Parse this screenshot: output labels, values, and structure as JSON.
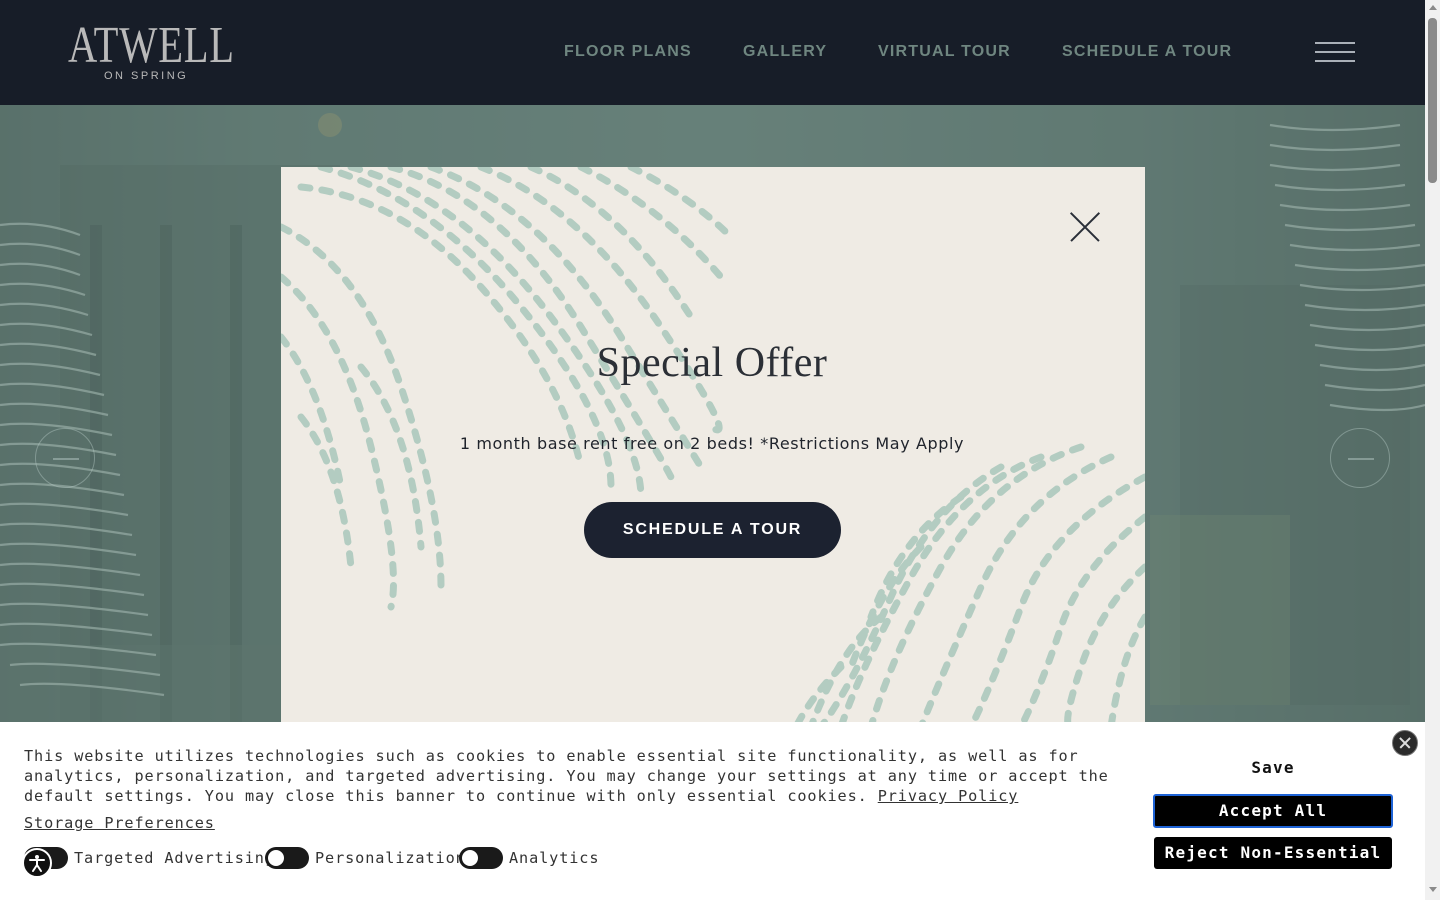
{
  "header": {
    "logo_main": "ATWELL",
    "logo_sub": "ON SPRING",
    "nav": [
      "FLOOR PLANS",
      "GALLERY",
      "VIRTUAL TOUR",
      "SCHEDULE A TOUR"
    ]
  },
  "modal": {
    "title": "Special Offer",
    "text": "1 month base rent free on 2 beds! *Restrictions May Apply",
    "button_label": "SCHEDULE A TOUR"
  },
  "cookie_banner": {
    "text": "This website utilizes technologies such as cookies to enable essential site functionality, as well as for analytics, personalization, and targeted advertising. You may change your settings at any time or accept the default settings. You may close this banner to continue with only essential cookies.",
    "privacy_link": "Privacy Policy",
    "storage_link": "Storage Preferences",
    "toggles": [
      {
        "label": "Targeted Advertising"
      },
      {
        "label": "Personalization"
      },
      {
        "label": "Analytics"
      }
    ],
    "save_label": "Save",
    "accept_label": "Accept All",
    "reject_label": "Reject Non-Essential"
  },
  "colors": {
    "header_bg": "#171d28",
    "nav_text": "#6f8680",
    "modal_bg": "#efebe4",
    "pattern": "#a9c7bb",
    "button_bg": "#1c2230",
    "accept_border": "#1e63d6"
  },
  "icons": {
    "menu": "hamburger-icon",
    "modal_close": "close-icon",
    "banner_close": "close-circle-icon",
    "accessibility": "accessibility-icon",
    "slider_prev": "arrow-left-icon",
    "slider_next": "arrow-right-icon"
  }
}
